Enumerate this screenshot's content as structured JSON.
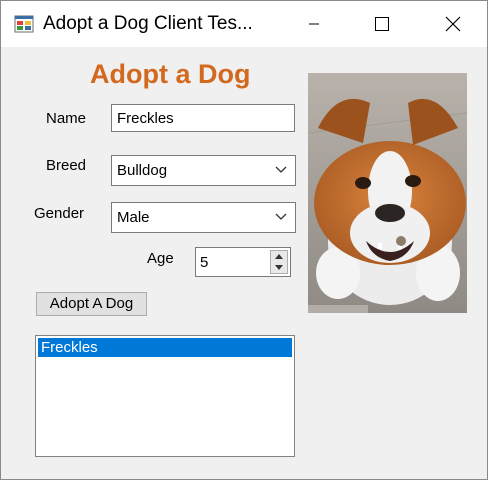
{
  "window": {
    "title": "Adopt a Dog Client Tes...",
    "controls": {
      "minimize": "minimize",
      "maximize": "maximize",
      "close": "close"
    }
  },
  "form": {
    "heading": "Adopt a Dog",
    "name_label": "Name",
    "name_value": "Freckles",
    "breed_label": "Breed",
    "breed_value": "Bulldog",
    "gender_label": "Gender",
    "gender_value": "Male",
    "age_label": "Age",
    "age_value": "5",
    "adopt_button": "Adopt A Dog"
  },
  "list": {
    "items": [
      "Freckles"
    ],
    "selected_index": 0
  },
  "colors": {
    "heading": "#d2691e",
    "selection": "#0078d7"
  },
  "photo": {
    "subject": "bulldog-photo",
    "caption": "www.dogbreed.com"
  }
}
